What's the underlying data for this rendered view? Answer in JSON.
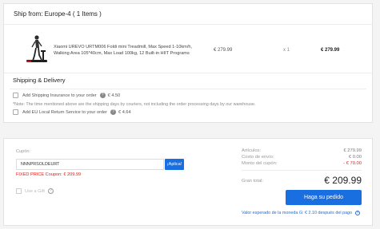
{
  "shipping_header": "Ship from: Europe-4 ( 1 Items )",
  "product": {
    "title": "Xiaomi UREVO URTM006 Foldi mini Treadmill, Max Speed 1-10km/h, Walking Area 105*40cm, Max Load 100kg, 12 Built-in HIIT Programs",
    "price": "€ 279.99",
    "qty": "x 1",
    "total": "€ 279.99",
    "image_icon": "treadmill-image"
  },
  "shipping_delivery": {
    "title": "Shipping & Delivery",
    "insurance_label": "Add Shipping Insurance to your order",
    "insurance_price": "€ 4.50",
    "note": "*Note: The time mentioned above are the shipping days by couriers, not including the order processing days by our warehouse.",
    "local_return_label": "Add EU Local Return Service to your order",
    "local_return_price": "€ 4.64"
  },
  "coupon": {
    "label": "Cupón:",
    "value": "NNNPRSOLDEURT",
    "apply_label": "¡Aplica!",
    "fixed_price_text": "FIXED PRICE Coupon: € 209.99"
  },
  "gift": {
    "label": "Use a Gift"
  },
  "summary": {
    "articles_label": "Artículos:",
    "articles_value": "€ 279.99",
    "shipping_label": "Costo de envío:",
    "shipping_value": "€ 0.00",
    "coupon_label": "Monto del cupón:",
    "coupon_value": "- € 70.00",
    "grand_label": "Gran total:",
    "grand_value": "€ 209.99",
    "order_button": "Haga su pedido",
    "expected_text": "Valor esperado de la moneda G: € 2.10 después del pago"
  },
  "colors": {
    "accent": "#1a6fe0",
    "danger": "#e0201a"
  }
}
